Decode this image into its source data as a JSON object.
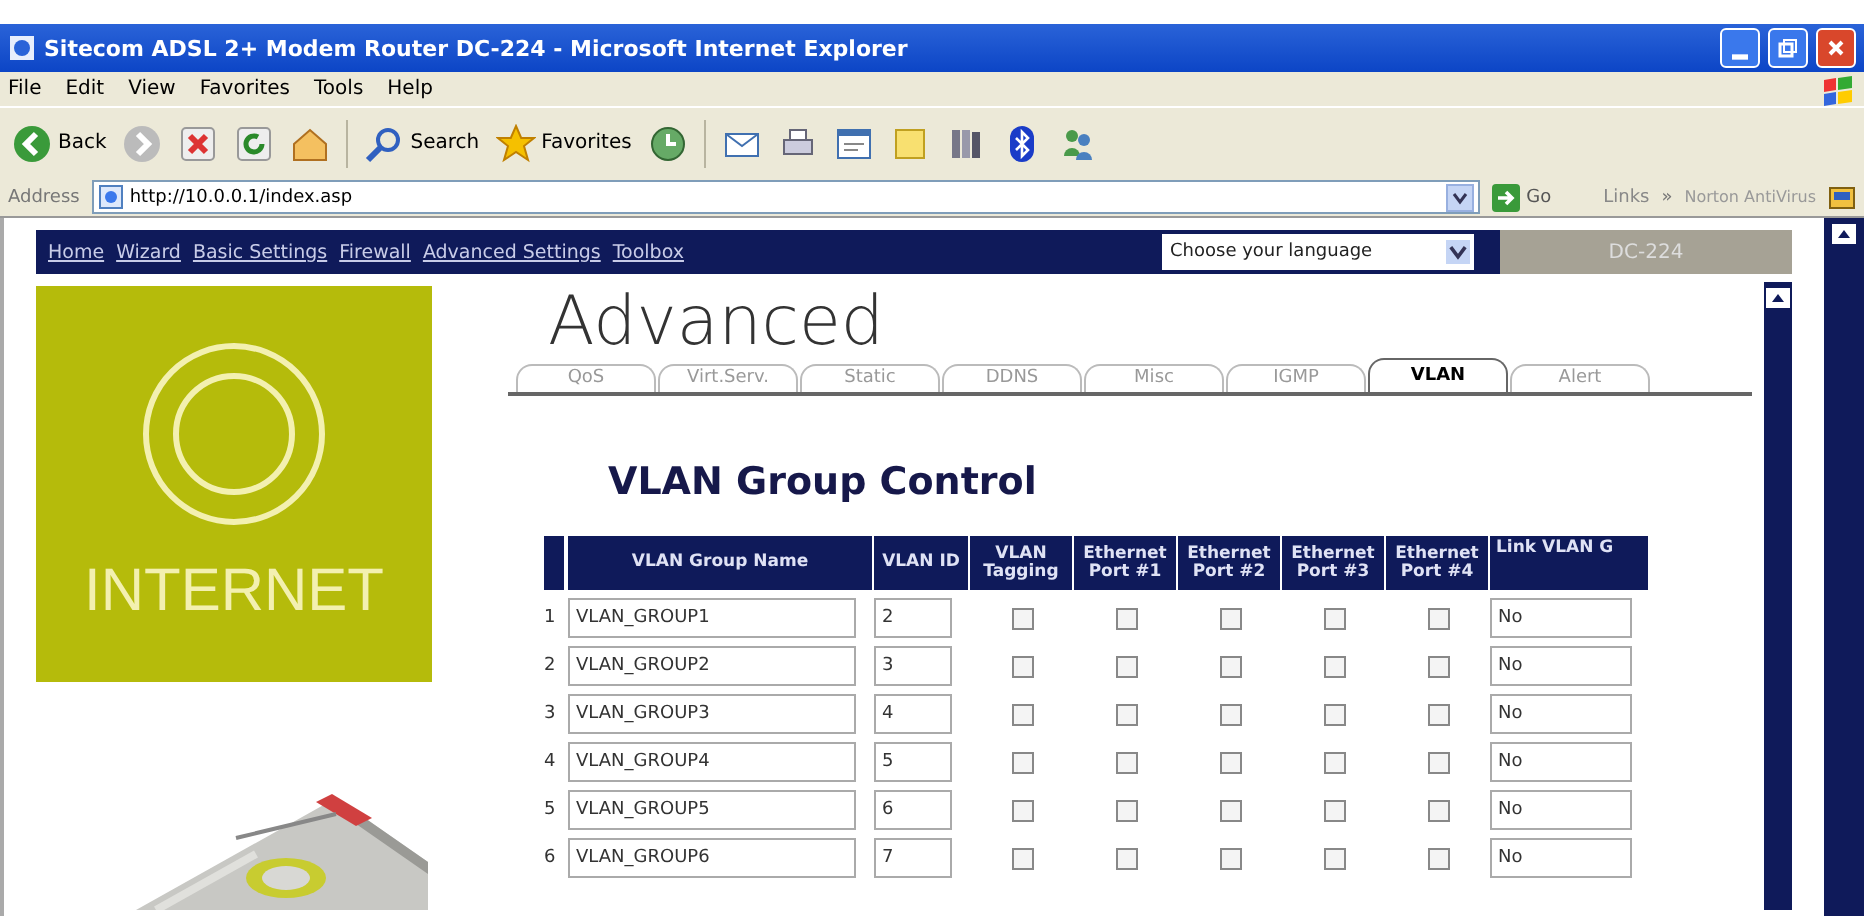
{
  "window": {
    "title": "Sitecom ADSL 2+ Modem Router DC-224 - Microsoft Internet Explorer"
  },
  "menu": [
    "File",
    "Edit",
    "View",
    "Favorites",
    "Tools",
    "Help"
  ],
  "toolbar": {
    "back": "Back",
    "search": "Search",
    "favorites": "Favorites"
  },
  "address": {
    "label": "Address",
    "value": "http://10.0.0.1/index.asp",
    "go": "Go",
    "links": "Links",
    "links_more": "»",
    "plugin": "Norton AntiVirus"
  },
  "nav": {
    "links": [
      "Home",
      "Wizard",
      "Basic Settings",
      "Firewall",
      "Advanced Settings",
      "Toolbox"
    ],
    "language": "Choose your language",
    "model": "DC-224"
  },
  "brand": {
    "label": "INTERNET"
  },
  "page_title": "Advanced",
  "tabs": [
    {
      "label": "QoS",
      "selected": false
    },
    {
      "label": "Virt.Serv.",
      "selected": false
    },
    {
      "label": "Static",
      "selected": false
    },
    {
      "label": "DDNS",
      "selected": false
    },
    {
      "label": "Misc",
      "selected": false
    },
    {
      "label": "IGMP",
      "selected": false
    },
    {
      "label": "VLAN",
      "selected": true
    },
    {
      "label": "Alert",
      "selected": false
    }
  ],
  "section_title": "VLAN Group Control",
  "table": {
    "columns": [
      "VLAN Group Name",
      "VLAN ID",
      "VLAN Tagging",
      "Ethernet Port #1",
      "Ethernet Port #2",
      "Ethernet Port #3",
      "Ethernet Port #4",
      "Link VLAN G"
    ],
    "rows": [
      {
        "index": "1",
        "name": "VLAN_GROUP1",
        "id": "2",
        "tagging": false,
        "ports": [
          false,
          false,
          false,
          false
        ],
        "link": "No"
      },
      {
        "index": "2",
        "name": "VLAN_GROUP2",
        "id": "3",
        "tagging": false,
        "ports": [
          false,
          false,
          false,
          false
        ],
        "link": "No"
      },
      {
        "index": "3",
        "name": "VLAN_GROUP3",
        "id": "4",
        "tagging": false,
        "ports": [
          false,
          false,
          false,
          false
        ],
        "link": "No"
      },
      {
        "index": "4",
        "name": "VLAN_GROUP4",
        "id": "5",
        "tagging": false,
        "ports": [
          false,
          false,
          false,
          false
        ],
        "link": "No"
      },
      {
        "index": "5",
        "name": "VLAN_GROUP5",
        "id": "6",
        "tagging": false,
        "ports": [
          false,
          false,
          false,
          false
        ],
        "link": "No"
      },
      {
        "index": "6",
        "name": "VLAN_GROUP6",
        "id": "7",
        "tagging": false,
        "ports": [
          false,
          false,
          false,
          false
        ],
        "link": "No"
      }
    ]
  }
}
